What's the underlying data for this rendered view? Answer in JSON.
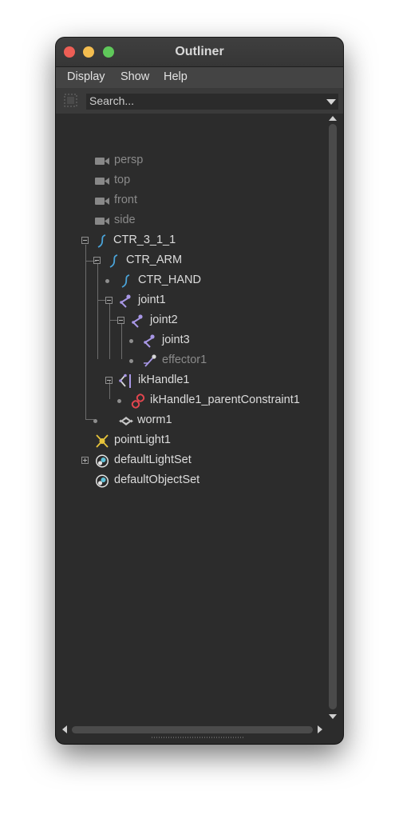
{
  "window": {
    "title": "Outliner"
  },
  "menubar": {
    "items": [
      "Display",
      "Show",
      "Help"
    ]
  },
  "search": {
    "placeholder": "Search..."
  },
  "tree": [
    {
      "label": "persp",
      "icon": "camera-icon",
      "dim": true
    },
    {
      "label": "top",
      "icon": "camera-icon",
      "dim": true
    },
    {
      "label": "front",
      "icon": "camera-icon",
      "dim": true
    },
    {
      "label": "side",
      "icon": "camera-icon",
      "dim": true
    },
    {
      "label": "CTR_3_1_1",
      "icon": "nurbs-curve-icon",
      "dim": false,
      "expanded": true
    },
    {
      "label": "CTR_ARM",
      "icon": "nurbs-curve-icon",
      "dim": false,
      "expanded": true
    },
    {
      "label": "CTR_HAND",
      "icon": "nurbs-curve-icon",
      "dim": false
    },
    {
      "label": "joint1",
      "icon": "joint-icon",
      "dim": false,
      "expanded": true
    },
    {
      "label": "joint2",
      "icon": "joint-icon",
      "dim": false,
      "expanded": true
    },
    {
      "label": "joint3",
      "icon": "joint-icon",
      "dim": false
    },
    {
      "label": "effector1",
      "icon": "effector-icon",
      "dim": true
    },
    {
      "label": "ikHandle1",
      "icon": "ik-handle-icon",
      "dim": false,
      "expanded": true
    },
    {
      "label": "ikHandle1_parentConstraint1",
      "icon": "parent-constraint-icon",
      "dim": false
    },
    {
      "label": "worm1",
      "icon": "group-icon",
      "dim": false
    },
    {
      "label": "pointLight1",
      "icon": "point-light-icon",
      "dim": false
    },
    {
      "label": "defaultLightSet",
      "icon": "object-set-icon",
      "dim": false,
      "expanded": false
    },
    {
      "label": "defaultObjectSet",
      "icon": "object-set-icon",
      "dim": false
    }
  ],
  "colors": {
    "window_bg": "#2c2c2c",
    "text": "#dcdcdc",
    "dim_text": "#8a8a8a",
    "curve": "#4aa3d8",
    "joint": "#a897e6",
    "constraint": "#e2464f",
    "light": "#e6c33a"
  }
}
